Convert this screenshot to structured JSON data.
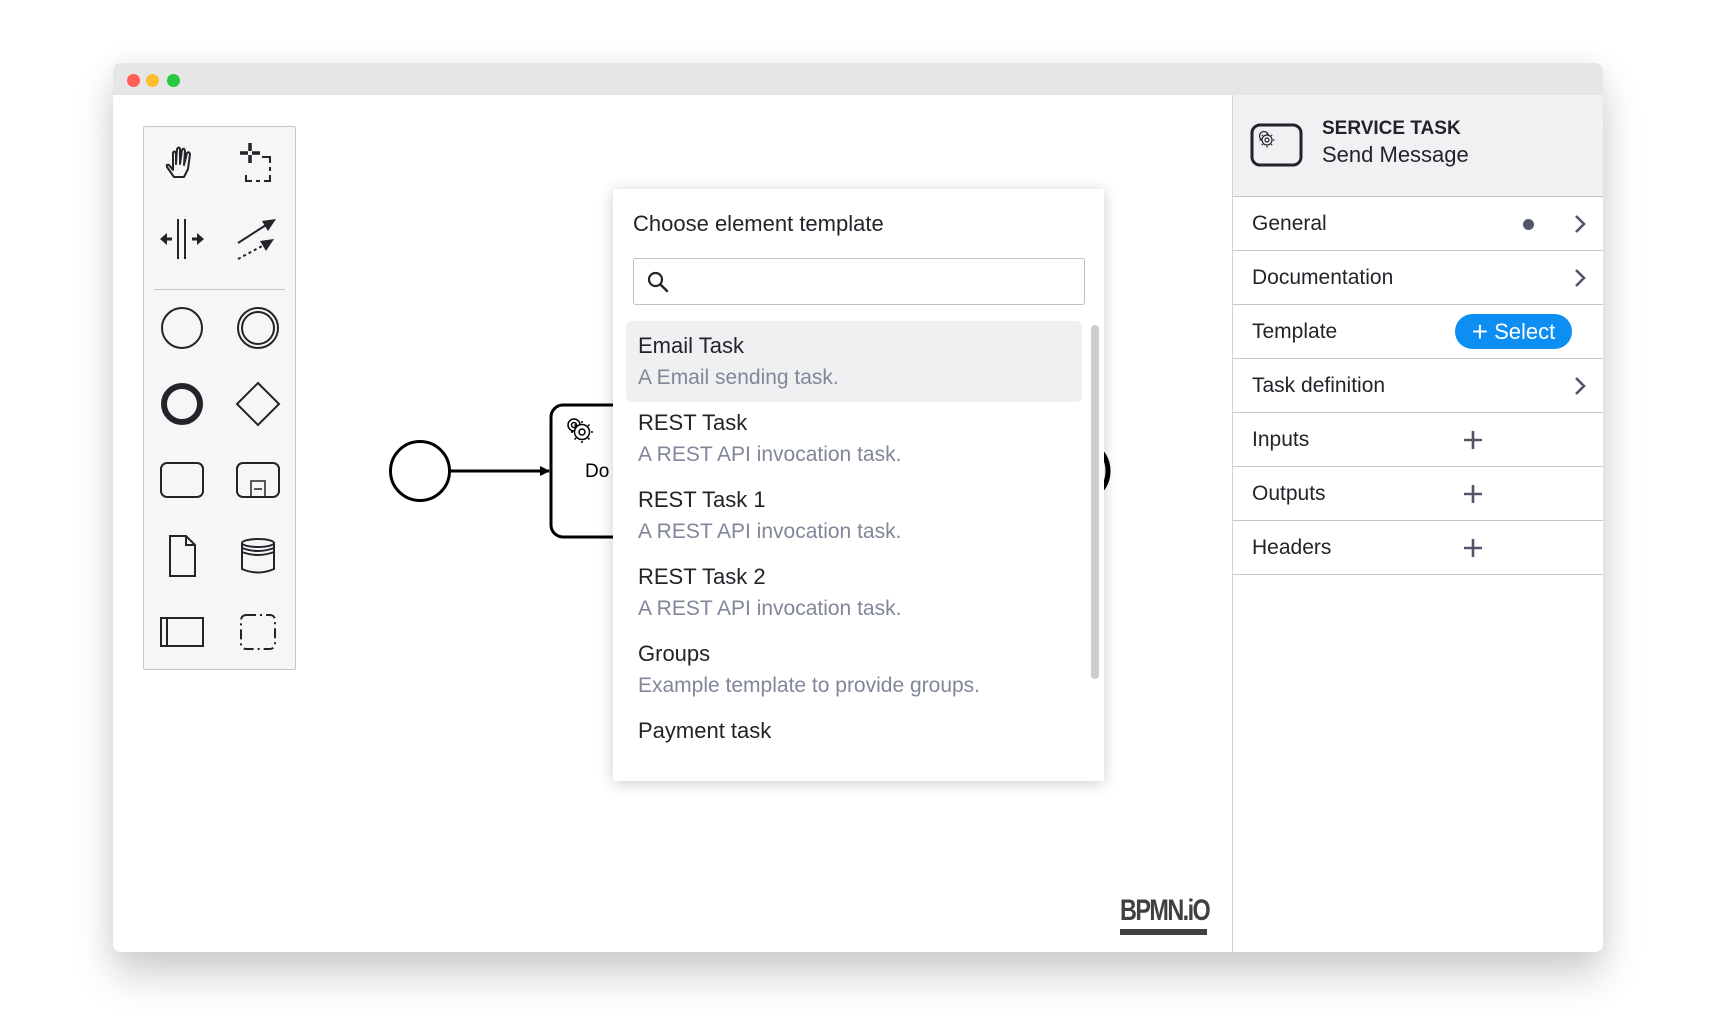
{
  "window": {
    "controls": [
      "close",
      "minimize",
      "maximize"
    ]
  },
  "palette": {
    "tools": [
      {
        "name": "hand-tool",
        "icon": "hand-icon"
      },
      {
        "name": "lasso-tool",
        "icon": "lasso-icon"
      },
      {
        "name": "space-tool",
        "icon": "space-tool-icon"
      },
      {
        "name": "global-connect-tool",
        "icon": "connect-icon"
      }
    ],
    "elements": [
      {
        "name": "start-event",
        "icon": "start-event-icon"
      },
      {
        "name": "intermediate-event",
        "icon": "intermediate-event-icon"
      },
      {
        "name": "end-event",
        "icon": "end-event-icon"
      },
      {
        "name": "gateway",
        "icon": "gateway-icon"
      },
      {
        "name": "task",
        "icon": "task-icon"
      },
      {
        "name": "subprocess",
        "icon": "subprocess-icon"
      },
      {
        "name": "data-object",
        "icon": "data-object-icon"
      },
      {
        "name": "data-store",
        "icon": "data-store-icon"
      },
      {
        "name": "pool",
        "icon": "pool-icon"
      },
      {
        "name": "group",
        "icon": "group-icon"
      }
    ]
  },
  "diagram": {
    "task_label_visible": "Do"
  },
  "logo": "BPMN.iO",
  "modal": {
    "title": "Choose element template",
    "search": {
      "value": "",
      "placeholder": ""
    },
    "templates": [
      {
        "name": "Email Task",
        "description": "A Email sending task.",
        "active": true
      },
      {
        "name": "REST Task",
        "description": "A REST API invocation task."
      },
      {
        "name": "REST Task 1",
        "description": "A REST API invocation task."
      },
      {
        "name": "REST Task 2",
        "description": "A REST API invocation task."
      },
      {
        "name": "Groups",
        "description": "Example template to provide groups."
      },
      {
        "name": "Payment task",
        "description": ""
      }
    ]
  },
  "properties": {
    "header": {
      "type": "SERVICE TASK",
      "name": "Send Message",
      "icon": "service-task-icon"
    },
    "groups": [
      {
        "label": "General",
        "action": "chevron",
        "has_dot": true
      },
      {
        "label": "Documentation",
        "action": "chevron"
      },
      {
        "label": "Template",
        "action": "select",
        "button_label": "Select"
      },
      {
        "label": "Task definition",
        "action": "chevron"
      },
      {
        "label": "Inputs",
        "action": "add"
      },
      {
        "label": "Outputs",
        "action": "add"
      },
      {
        "label": "Headers",
        "action": "add"
      }
    ]
  },
  "colors": {
    "accent": "#0d8ef2",
    "selected_item_bg": "#eff0f2",
    "description_text": "#818798",
    "panel_header_bg": "#f0f1f3"
  }
}
